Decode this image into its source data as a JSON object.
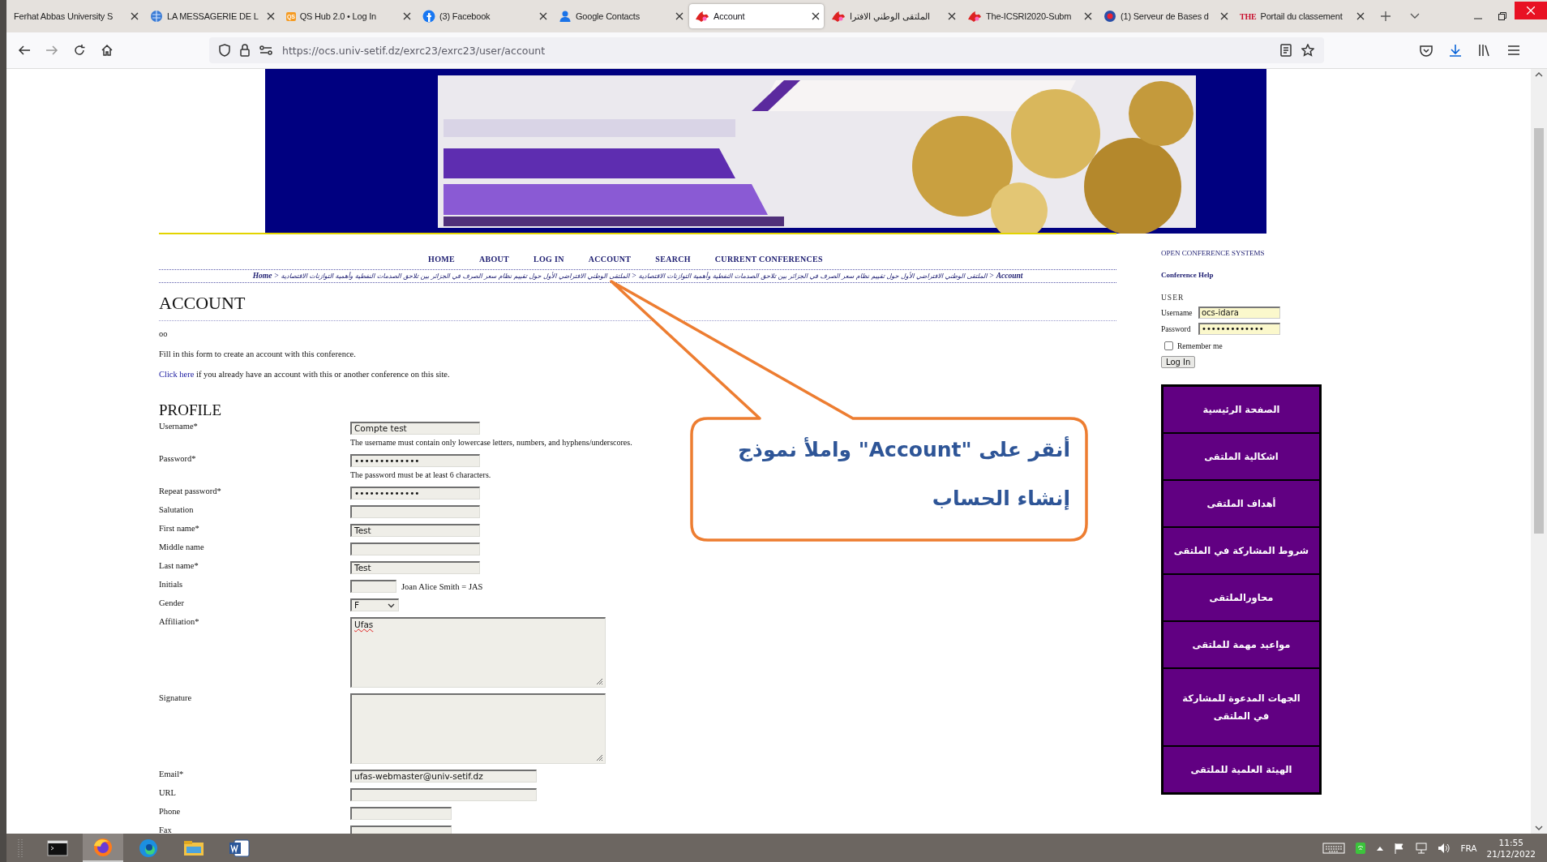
{
  "browser": {
    "tabs": [
      {
        "title": "Ferhat Abbas University S",
        "kind": "none",
        "selected": false
      },
      {
        "title": "LA MESSAGERIE DE L",
        "kind": "globe",
        "selected": false
      },
      {
        "title": "QS Hub 2.0 • Log In",
        "kind": "badge",
        "icon_text": "QS",
        "selected": false
      },
      {
        "title": "(3) Facebook",
        "kind": "facebook",
        "selected": false
      },
      {
        "title": "Google Contacts",
        "kind": "contacts",
        "selected": false
      },
      {
        "title": "Account",
        "kind": "redmark",
        "selected": true
      },
      {
        "title": "الملتقى الوطني الافترا",
        "kind": "redmark",
        "selected": false
      },
      {
        "title": "The-ICSRI2020-Subm",
        "kind": "redmark",
        "selected": false
      },
      {
        "title": "(1) Serveur de Bases d",
        "kind": "emblem",
        "selected": false
      },
      {
        "title": "Portail du classement",
        "kind": "lettermark",
        "icon_text": "THE",
        "selected": false
      }
    ],
    "url": "https://ocs.univ-setif.dz/exrc23/exrc23/user/account"
  },
  "page": {
    "nav": [
      "HOME",
      "ABOUT",
      "LOG IN",
      "ACCOUNT",
      "SEARCH",
      "CURRENT CONFERENCES"
    ],
    "breadcrumb": {
      "separator": ">",
      "items": [
        {
          "text": "Home",
          "kind": "link"
        },
        {
          "text": "الملتقى الوطني الافتراضي الأول حول تقييم نظام سعر الصرف في الجزائر بين تلاحق الصدمات النفطية وأهمية التوازنات الاقتصادية",
          "kind": "path"
        },
        {
          "text": "الملتقى الوطني الافتراضي الأول حول تقييم نظام سعر الصرف في الجزائر بين تلاحق الصدمات النفطية وأهمية التوازنات الاقتصادية",
          "kind": "path"
        },
        {
          "text": "Account",
          "kind": "current"
        }
      ]
    },
    "title": "ACCOUNT",
    "note": "oo",
    "intro": "Fill in this form to create an account with this conference.",
    "login_prompt": {
      "link": "Click here",
      "text": " if you already have an account with this or another conference on this site."
    },
    "profile": {
      "heading": "PROFILE",
      "fields": [
        {
          "label": "Username*",
          "kind": "text",
          "value": "Compte test",
          "hint": "The username must contain only lowercase letters, numbers, and hyphens/underscores."
        },
        {
          "label": "Password*",
          "kind": "text",
          "value": "•••••••••••••",
          "hint": "The password must be at least 6 characters."
        },
        {
          "label": "Repeat password*",
          "kind": "text",
          "value": "•••••••••••••"
        },
        {
          "label": "Salutation",
          "kind": "text"
        },
        {
          "label": "First name*",
          "kind": "text",
          "value": "Test"
        },
        {
          "label": "Middle name",
          "kind": "text"
        },
        {
          "label": "Last name*",
          "kind": "text",
          "value": "Test"
        },
        {
          "label": "Initials",
          "kind": "short",
          "note": "Joan Alice Smith = JAS"
        },
        {
          "label": "Gender",
          "kind": "select",
          "value": "F"
        },
        {
          "label": "Affiliation*",
          "kind": "textarea",
          "value": "Ufas",
          "misspelled": true
        },
        {
          "label": "Signature",
          "kind": "textarea"
        },
        {
          "label": "Email*",
          "kind": "wide",
          "value": "ufas-webmaster@univ-setif.dz"
        },
        {
          "label": "URL",
          "kind": "wide"
        },
        {
          "label": "Phone",
          "kind": "medium"
        },
        {
          "label": "Fax",
          "kind": "medium"
        }
      ]
    }
  },
  "sidebar": {
    "links": [
      "OPEN CONFERENCE SYSTEMS",
      "Conference Help"
    ],
    "user": {
      "heading": "USER",
      "username_label": "Username",
      "username": "ocs-idara",
      "password_label": "Password",
      "password": "•••••••••••••",
      "remember_label": "Remember me",
      "remember": false,
      "button": "Log In"
    },
    "menu": [
      "الصفحة الرئيسية",
      "اشكالية الملتقى",
      "أهداف الملتقى",
      "شروط المشاركة في الملتقى",
      "محاورالملتقى",
      "مواعيد مهمة للملتقى",
      "الجهات المدعوة للمشاركة في الملتقى",
      "الهيئة العلمية للملتقى"
    ]
  },
  "callout": {
    "text": "أنقر على \"Account\" واملأ نموذج إنشاء الحساب"
  },
  "taskbar": {
    "apps": [
      {
        "kind": "terminal",
        "selected": false
      },
      {
        "kind": "firefox",
        "selected": true
      },
      {
        "kind": "edge",
        "selected": false
      },
      {
        "kind": "explorer",
        "selected": false
      },
      {
        "kind": "word",
        "selected": false
      }
    ],
    "language": "FRA",
    "time": "11:55",
    "date": "21/12/2022"
  }
}
